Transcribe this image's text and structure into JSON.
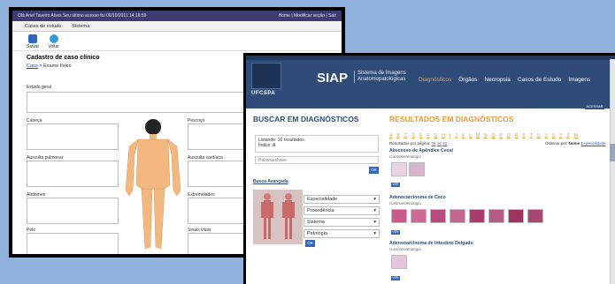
{
  "back_window": {
    "topbar_left": "Olá Ariel Taveiro Alves  Seu último acesso foi 06/10/2011 14:16:59",
    "topbar_right": "Home | Modificar seção | Sair",
    "menu": [
      "Casos de estudo",
      "Sistema"
    ],
    "toolbar": {
      "save_label": "Salvar",
      "back_label": "Voltar"
    },
    "page_title": "Cadastro de caso clínico",
    "breadcrumb": {
      "link": "Caso",
      "rest": " > Exame físico"
    },
    "fields": {
      "estado_geral": "Estado geral",
      "cabeca": "Cabeça",
      "pescoco": "Pescoço",
      "ausculta_pulmonar": "Ausculta pulmonar",
      "ausculta_cardiaca": "Ausculta cardíaca",
      "abdomen": "Abdomen",
      "extremidades": "Extremidades",
      "pele": "Pele",
      "sinais_vitais": "Sinais vitais"
    }
  },
  "front_window": {
    "logo_text": "UFCSPA",
    "brand": "SIAP",
    "brand_sub_1": "Sistema de Imagens",
    "brand_sub_2": "Anatomopatológicas",
    "nav": [
      "Diagnósticos",
      "Órgãos",
      "Necropsia",
      "Casos de Estudo",
      "Imagens"
    ],
    "area_restrita": "ÁREA RESTRITA",
    "acessar_label": "ACESSAR",
    "left_title": "BUSCAR EM DIAGNÓSTICOS",
    "listing_line1": "Listando: 16 resultados.",
    "listing_line2": "Índice: A",
    "keyword_placeholder": "Palavra-chave",
    "ok_label": "OK",
    "busca_avancada": "Busca Avançada",
    "selects": [
      "Especialidade",
      "Procedência",
      "Sistema",
      "Patologia"
    ],
    "right_title": "RESULTADOS EM DIAGNÓSTICOS",
    "alphabet": [
      "A",
      "B",
      "C",
      "D",
      "E",
      "F",
      "G",
      "H",
      "I",
      "J",
      "K",
      "L",
      "M",
      "N",
      "O",
      "P",
      "Q",
      "R",
      "S",
      "T",
      "U",
      "V",
      "X",
      "Y",
      "Z",
      "W"
    ],
    "results_per_page_label": "Resultados por página:",
    "results_per_page": [
      "08",
      "16",
      "32"
    ],
    "order_label": "Ordenar por:",
    "order_options": [
      "Nome",
      "Especialidade"
    ],
    "items": [
      {
        "title": "Abscesso de Apêndice Cecal",
        "sub": "Gastroenterologia"
      },
      {
        "title": "Adenocarcinoma de Ceco",
        "sub": "Gastroenterologia"
      },
      {
        "title": "Adenocarcinoma de Intestino Delgado",
        "sub": "Gastroenterologia"
      }
    ],
    "ver_label": "VER"
  }
}
